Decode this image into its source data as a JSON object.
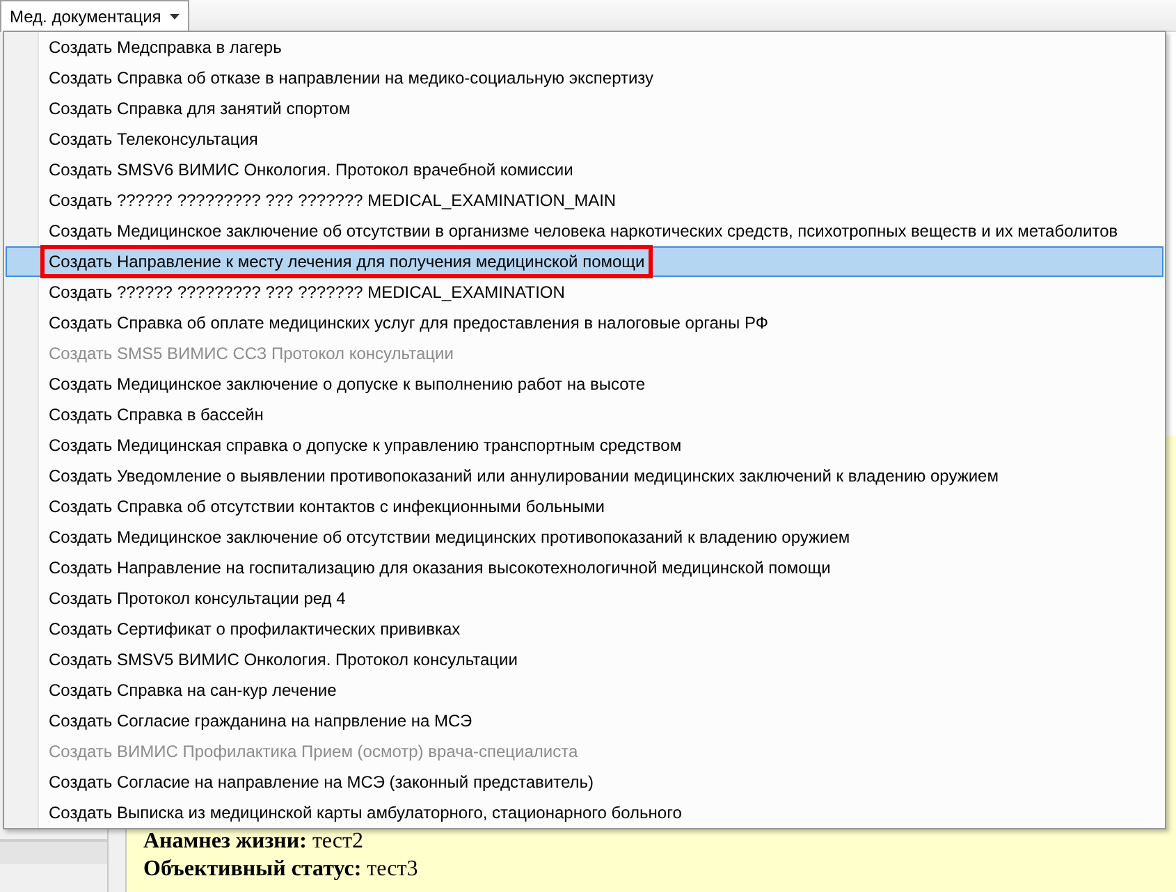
{
  "toolbar": {
    "menu_button": {
      "label": "Мед. документация",
      "expanded": true
    }
  },
  "menu": {
    "items": [
      {
        "label": "Создать Медсправка в лагерь",
        "selected": false,
        "disabled": false,
        "framed": false
      },
      {
        "label": "Создать Справка об отказе в направлении на медико-социальную экспертизу",
        "selected": false,
        "disabled": false,
        "framed": false
      },
      {
        "label": "Создать Справка для занятий спортом",
        "selected": false,
        "disabled": false,
        "framed": false
      },
      {
        "label": "Создать Телеконсультация",
        "selected": false,
        "disabled": false,
        "framed": false
      },
      {
        "label": "Создать SMSV6 ВИМИС Онкология. Протокол врачебной комиссии",
        "selected": false,
        "disabled": false,
        "framed": false
      },
      {
        "label": "Создать ?????? ????????? ??? ??????? MEDICAL_EXAMINATION_MAIN",
        "selected": false,
        "disabled": false,
        "framed": false
      },
      {
        "label": "Создать Медицинское заключение об отсутствии в организме человека наркотических средств, психотропных веществ и их метаболитов",
        "selected": false,
        "disabled": false,
        "framed": false
      },
      {
        "label": "Создать Направление к месту лечения для получения медицинской помощи",
        "selected": true,
        "disabled": false,
        "framed": true
      },
      {
        "label": "Создать ?????? ????????? ??? ??????? MEDICAL_EXAMINATION",
        "selected": false,
        "disabled": false,
        "framed": false
      },
      {
        "label": "Создать Справка об оплате медицинских услуг для предоставления в налоговые органы РФ",
        "selected": false,
        "disabled": false,
        "framed": false
      },
      {
        "label": "Создать SMS5 ВИМИС ССЗ Протокол консультации",
        "selected": false,
        "disabled": true,
        "framed": false
      },
      {
        "label": "Создать Медицинское заключение о допуске к выполнению работ на высоте",
        "selected": false,
        "disabled": false,
        "framed": false
      },
      {
        "label": "Создать Справка в бассейн",
        "selected": false,
        "disabled": false,
        "framed": false
      },
      {
        "label": "Создать Медицинская справка о допуске к управлению транспортным средством",
        "selected": false,
        "disabled": false,
        "framed": false
      },
      {
        "label": "Создать Уведомление о выявлении противопоказаний или аннулировании медицинских заключений к владению оружием",
        "selected": false,
        "disabled": false,
        "framed": false
      },
      {
        "label": "Создать Справка об отсутствии контактов с инфекционными больными",
        "selected": false,
        "disabled": false,
        "framed": false
      },
      {
        "label": "Создать Медицинское заключение об отсутствии медицинских противопоказаний к владению оружием",
        "selected": false,
        "disabled": false,
        "framed": false
      },
      {
        "label": "Создать Направление на госпитализацию для оказания высокотехнологичной медицинской помощи",
        "selected": false,
        "disabled": false,
        "framed": false
      },
      {
        "label": "Создать Протокол консультации ред 4",
        "selected": false,
        "disabled": false,
        "framed": false
      },
      {
        "label": "Создать Сертификат о профилактических прививках",
        "selected": false,
        "disabled": false,
        "framed": false
      },
      {
        "label": "Создать SMSV5 ВИМИС Онкология. Протокол консультации",
        "selected": false,
        "disabled": false,
        "framed": false
      },
      {
        "label": "Создать Справка на сан-кур лечение",
        "selected": false,
        "disabled": false,
        "framed": false
      },
      {
        "label": "Создать Согласие гражданина на напрвление на МСЭ",
        "selected": false,
        "disabled": false,
        "framed": false
      },
      {
        "label": "Создать ВИМИС Профилактика Прием (осмотр) врача-специалиста",
        "selected": false,
        "disabled": true,
        "framed": false
      },
      {
        "label": "Создать Согласие на направление на МСЭ (законный представитель)",
        "selected": false,
        "disabled": false,
        "framed": false
      },
      {
        "label": "Создать Выписка из медицинской карты амбулаторного, стационарного больного",
        "selected": false,
        "disabled": false,
        "framed": false
      }
    ]
  },
  "document": {
    "lines": [
      {
        "label": "Анамнез жизни:",
        "value": "тест2"
      },
      {
        "label": "Объективный статус:",
        "value": "тест3"
      }
    ]
  }
}
